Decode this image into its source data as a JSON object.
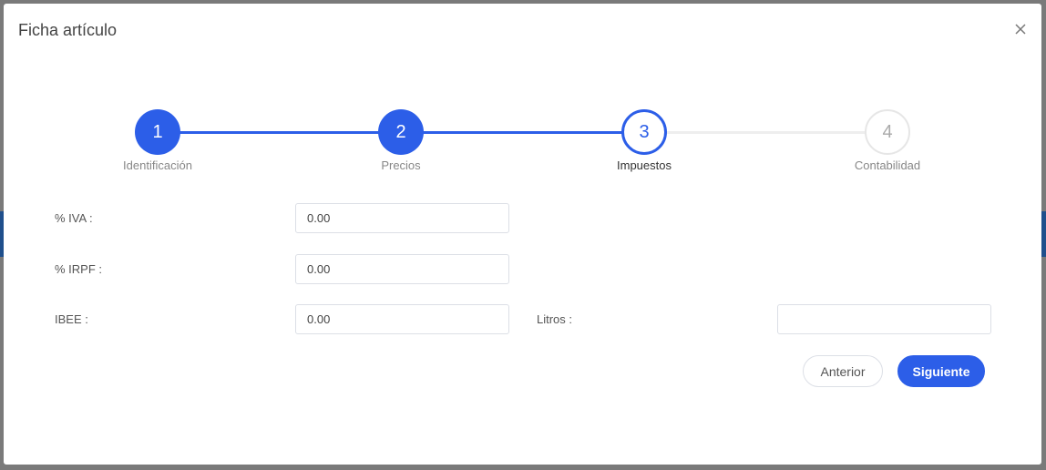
{
  "dialog": {
    "title": "Ficha artículo",
    "close_icon": "close-icon"
  },
  "stepper": {
    "active_color": "#2c5ee8",
    "inactive_color": "#eeeeee",
    "steps": [
      {
        "number": "1",
        "label": "Identificación",
        "state": "done"
      },
      {
        "number": "2",
        "label": "Precios",
        "state": "done"
      },
      {
        "number": "3",
        "label": "Impuestos",
        "state": "current"
      },
      {
        "number": "4",
        "label": "Contabilidad",
        "state": "todo"
      }
    ]
  },
  "form": {
    "iva": {
      "label": "% IVA :",
      "value": "0.00"
    },
    "irpf": {
      "label": "% IRPF :",
      "value": "0.00"
    },
    "ibee": {
      "label": "IBEE :",
      "value": "0.00"
    },
    "litros": {
      "label": "Litros :",
      "value": ""
    }
  },
  "actions": {
    "previous_label": "Anterior",
    "next_label": "Siguiente"
  }
}
